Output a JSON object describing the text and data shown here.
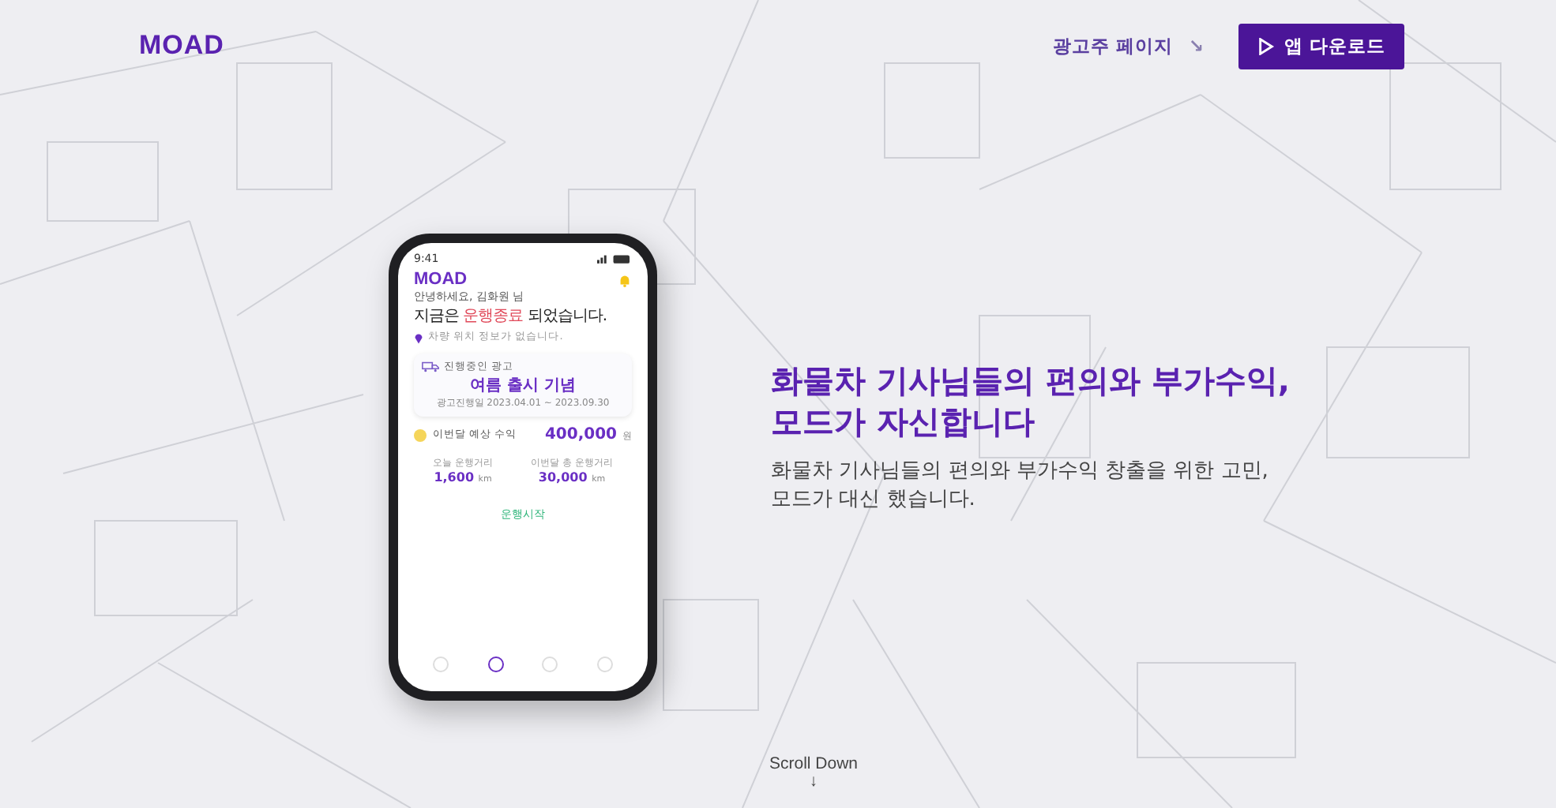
{
  "header": {
    "logo": "MOAD",
    "advertiser_link": "광고주 페이지",
    "advertiser_arrow": "↘",
    "download_button": "앱 다운로드"
  },
  "phone": {
    "time": "9:41",
    "logo": "MOAD",
    "greeting": "안녕하세요, 김화원 님",
    "status": {
      "before": "지금은 ",
      "highlight": "운행종료",
      "after": " 되었습니다."
    },
    "location": "차량 위치 정보가 없습니다.",
    "ad_card": {
      "label": "진행중인 광고",
      "title": "여름 출시 기념",
      "period": "광고진행일 2023.04.01 ~ 2023.09.30"
    },
    "earnings": {
      "label": "이번달 예상 수익",
      "amount": "400,000",
      "unit": "원"
    },
    "stats": [
      {
        "label": "오늘 운행거리",
        "value": "1,600",
        "unit": "km"
      },
      {
        "label": "이번달 총 운행거리",
        "value": "30,000",
        "unit": "km"
      }
    ],
    "start_button": "운행시작",
    "nav": [
      {
        "selected": false
      },
      {
        "selected": true
      },
      {
        "selected": false
      },
      {
        "selected": false
      }
    ]
  },
  "hero": {
    "title_lines": [
      "화물차 기사님들의 편의와 부가수익,",
      "모드가 자신합니다"
    ],
    "subtitle_lines": [
      "화물차 기사님들의 편의와 부가수익 창출을 위한 고민,",
      "모드가 대신 했습니다."
    ]
  },
  "scroll_hint": {
    "label": "Scroll Down",
    "arrow": "↓"
  }
}
